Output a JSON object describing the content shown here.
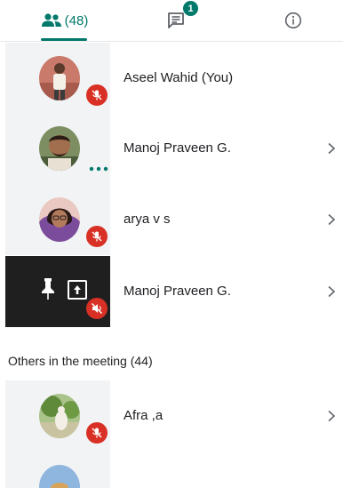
{
  "tabs": {
    "people_count": "(48)",
    "chat_badge": "1"
  },
  "participants": [
    {
      "name": "Aseel Wahid (You)",
      "muted": true
    },
    {
      "name": "Manoj Praveen G.",
      "muted": false,
      "speaking": true
    },
    {
      "name": "arya v s",
      "muted": true
    },
    {
      "name": "Manoj Praveen G.",
      "muted": true,
      "presenting": true
    }
  ],
  "others": {
    "heading": "Others in the meeting (44)",
    "items": [
      {
        "name": "Afra ,a",
        "muted": true
      }
    ]
  },
  "colors": {
    "accent": "#00796b",
    "muted_badge": "#d93025",
    "tile_bg": "#f1f3f4",
    "presenting_tile_bg": "#1f1f1f"
  },
  "icons": {
    "people": "people-icon",
    "chat": "chat-icon",
    "info": "info-icon",
    "mic_off": "mic-off-icon",
    "chevron": "chevron-right-icon",
    "pin": "pin-icon",
    "present": "present-screen-icon"
  }
}
